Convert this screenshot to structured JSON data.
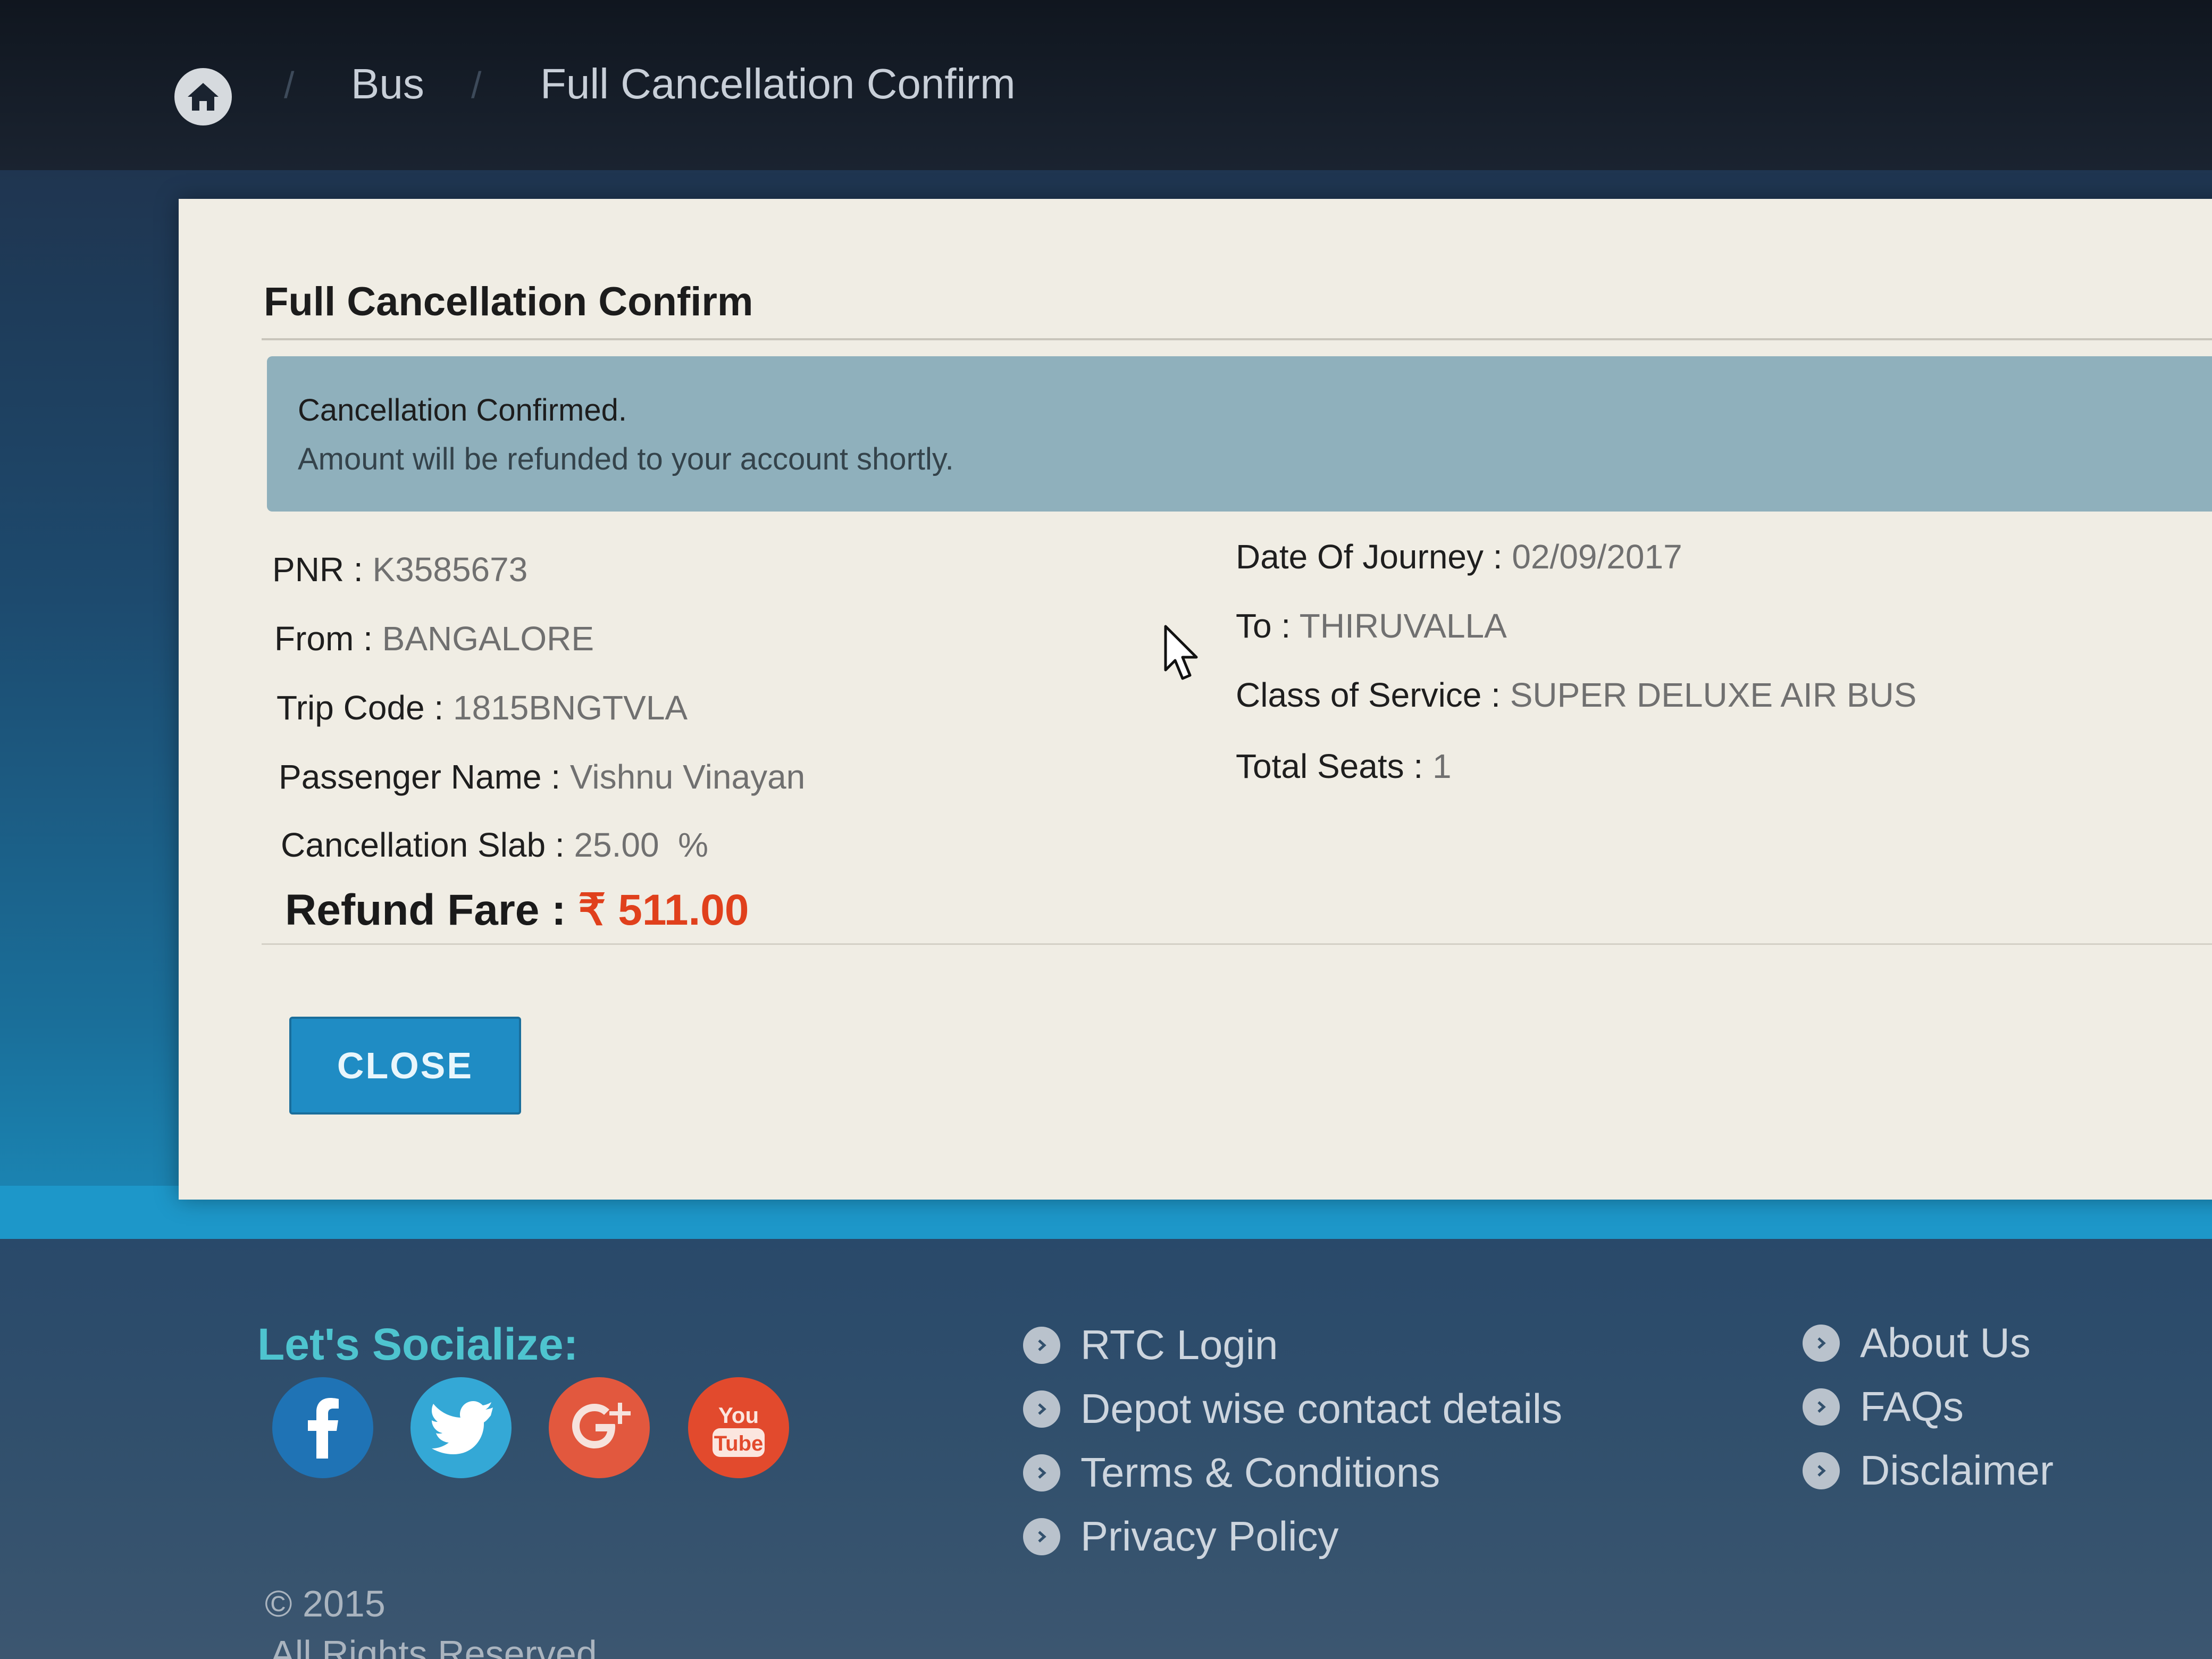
{
  "breadcrumb": {
    "home_icon": "home-icon",
    "separator": "/",
    "items": [
      "Bus",
      "Full Cancellation Confirm"
    ]
  },
  "card": {
    "title": "Full Cancellation Confirm",
    "alert": {
      "line1": "Cancellation Confirmed.",
      "line2": "Amount will be refunded to your account shortly."
    },
    "details_left": [
      {
        "label": "PNR : ",
        "value": "K3585673"
      },
      {
        "label": "From : ",
        "value": "BANGALORE"
      },
      {
        "label": "Trip Code : ",
        "value": "1815BNGTVLA"
      },
      {
        "label": "Passenger Name : ",
        "value": "Vishnu Vinayan"
      },
      {
        "label": "Cancellation Slab : ",
        "value": "25.00  %"
      }
    ],
    "details_right": [
      {
        "label": "Date Of Journey : ",
        "value": "02/09/2017"
      },
      {
        "label": "To : ",
        "value": "THIRUVALLA"
      },
      {
        "label": "Class of Service : ",
        "value": "SUPER DELUXE AIR BUS"
      },
      {
        "label": "Total Seats : ",
        "value": "1"
      }
    ],
    "refund": {
      "label": "Refund Fare : ",
      "value": "₹ 511.00"
    },
    "close_label": "CLOSE"
  },
  "footer": {
    "social_title": "Let's Socialize:",
    "social": [
      {
        "name": "facebook-icon",
        "color": "#1f73b5"
      },
      {
        "name": "twitter-icon",
        "color": "#34a8d6"
      },
      {
        "name": "google-plus-icon",
        "color": "#e2583e"
      },
      {
        "name": "youtube-icon",
        "color": "#e24a2d",
        "text_top": "You",
        "text_bottom": "Tube"
      }
    ],
    "links_col1": [
      "RTC Login",
      "Depot wise contact details",
      "Terms & Conditions",
      "Privacy Policy"
    ],
    "links_col2": [
      "About Us",
      "FAQs",
      "Disclaimer"
    ],
    "copyright": "© 2015",
    "rights": "All Rights Reserved"
  },
  "colors": {
    "accent": "#1f8cc4",
    "refund": "#e0401c",
    "social_title": "#4ec4cf"
  }
}
